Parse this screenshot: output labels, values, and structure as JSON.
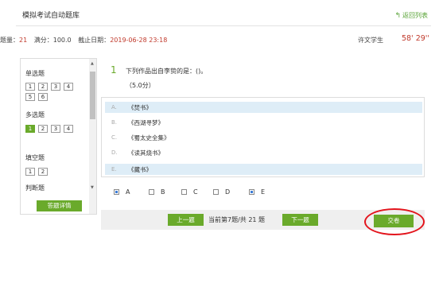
{
  "header": {
    "title": "模拟考试自动题库",
    "back_label": "返回列表"
  },
  "info": {
    "count_label": "题量：",
    "count_value": "21",
    "score_label": "满分：",
    "score_value": "100.0",
    "deadline_label": "截止日期：",
    "deadline_value": "2019-06-28 23:18",
    "user": "许文学生",
    "timer": "58' 29''"
  },
  "sidebar": {
    "sections": [
      {
        "title": "单选题",
        "numbers": [
          "1",
          "2",
          "3",
          "4",
          "5",
          "6"
        ],
        "active": []
      },
      {
        "title": "多选题",
        "numbers": [
          "1",
          "2",
          "3",
          "4"
        ],
        "active": [
          "1"
        ]
      },
      {
        "title": "填空题",
        "numbers": [
          "1",
          "2"
        ],
        "active": []
      },
      {
        "title": "判断题",
        "numbers": [],
        "active": []
      }
    ],
    "detail_button": "答题详情"
  },
  "question": {
    "number": "1",
    "text": "下列作品出自李贽的是：()。",
    "score": "（5.0分）",
    "options": [
      {
        "letter": "A.",
        "text": "《焚书》",
        "highlight": true
      },
      {
        "letter": "B.",
        "text": "《西湖寻梦》",
        "highlight": false
      },
      {
        "letter": "C.",
        "text": "《蜀太史全集》",
        "highlight": false
      },
      {
        "letter": "D.",
        "text": "《读其烧书》",
        "highlight": false
      },
      {
        "letter": "E.",
        "text": "《藏书》",
        "highlight": true
      }
    ]
  },
  "answers": [
    {
      "label": "A",
      "checked": true
    },
    {
      "label": "B",
      "checked": false
    },
    {
      "label": "C",
      "checked": false
    },
    {
      "label": "D",
      "checked": false
    },
    {
      "label": "E",
      "checked": true
    }
  ],
  "nav": {
    "prev": "上一题",
    "progress": "当前第7题/共 21 题",
    "next": "下一题",
    "submit": "交卷"
  },
  "colors": {
    "accent": "#6aaa2b",
    "highlight_row": "#deedf7",
    "value_red": "#c0392b",
    "annotation_red": "#e3141c"
  }
}
